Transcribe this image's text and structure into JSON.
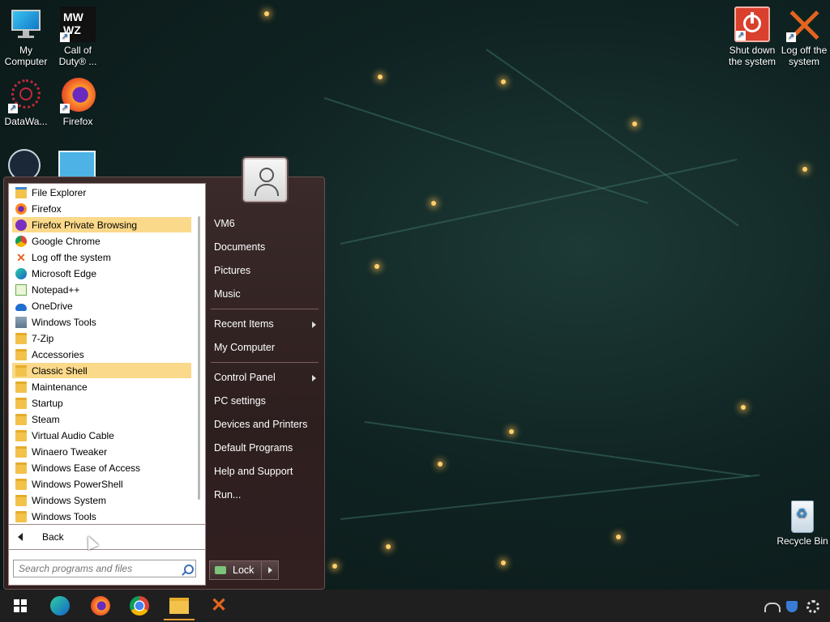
{
  "desktop": {
    "icons": [
      {
        "label": "My Computer"
      },
      {
        "label": "Call of Duty® ..."
      },
      {
        "label": "DataWa..."
      },
      {
        "label": "Firefox"
      },
      {
        "label": "Shut down the system"
      },
      {
        "label": "Log off the system"
      },
      {
        "label": "Recycle Bin"
      }
    ]
  },
  "start_menu": {
    "programs": [
      {
        "label": "File Explorer"
      },
      {
        "label": "Firefox"
      },
      {
        "label": "Firefox Private Browsing"
      },
      {
        "label": "Google Chrome"
      },
      {
        "label": "Log off the system"
      },
      {
        "label": "Microsoft Edge"
      },
      {
        "label": "Notepad++"
      },
      {
        "label": "OneDrive"
      },
      {
        "label": "Windows Tools"
      },
      {
        "label": "7-Zip"
      },
      {
        "label": "Accessories"
      },
      {
        "label": "Classic Shell"
      },
      {
        "label": "Maintenance"
      },
      {
        "label": "Startup"
      },
      {
        "label": "Steam"
      },
      {
        "label": "Virtual Audio Cable"
      },
      {
        "label": "Winaero Tweaker"
      },
      {
        "label": "Windows Ease of Access"
      },
      {
        "label": "Windows PowerShell"
      },
      {
        "label": "Windows System"
      },
      {
        "label": "Windows Tools"
      }
    ],
    "back_label": "Back",
    "search_placeholder": "Search programs and files",
    "right_links": [
      {
        "label": "VM6"
      },
      {
        "label": "Documents"
      },
      {
        "label": "Pictures"
      },
      {
        "label": "Music"
      },
      {
        "label": "Recent Items"
      },
      {
        "label": "My Computer"
      },
      {
        "label": "Control Panel"
      },
      {
        "label": "PC settings"
      },
      {
        "label": "Devices and Printers"
      },
      {
        "label": "Default Programs"
      },
      {
        "label": "Help and Support"
      },
      {
        "label": "Run..."
      }
    ],
    "lock_label": "Lock"
  },
  "colors": {
    "menu_highlight": "#fbd98a",
    "menu_bg": "#2e1f1f",
    "taskbar_bg": "#1f1f1f"
  }
}
